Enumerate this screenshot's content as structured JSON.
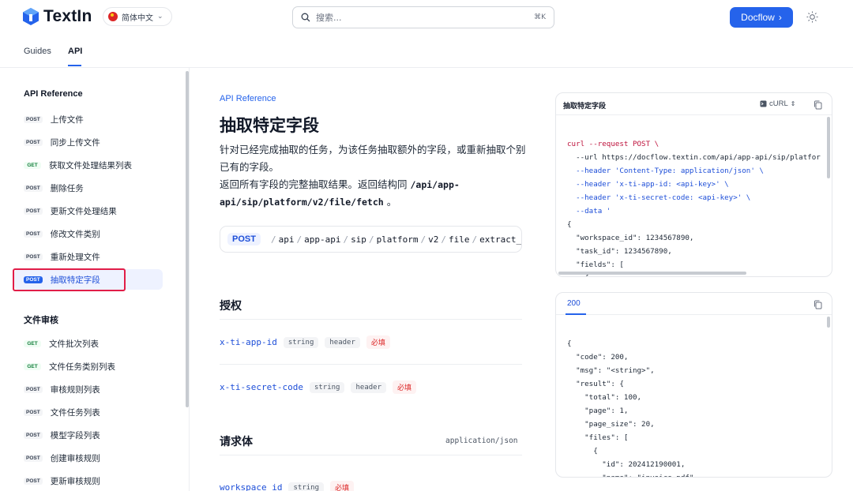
{
  "header": {
    "logo_text": "TextIn",
    "language": "简体中文",
    "search_placeholder": "搜索...",
    "search_shortcut": "⌘K",
    "docflow_label": "Docflow",
    "docflow_arrow": "›"
  },
  "tabs": [
    {
      "label": "Guides"
    },
    {
      "label": "API"
    }
  ],
  "sidebar": {
    "sections": [
      {
        "title": "API Reference",
        "items": [
          {
            "method": "POST",
            "label": "上传文件"
          },
          {
            "method": "POST",
            "label": "同步上传文件"
          },
          {
            "method": "GET",
            "label": "获取文件处理结果列表"
          },
          {
            "method": "POST",
            "label": "删除任务"
          },
          {
            "method": "POST",
            "label": "更新文件处理结果"
          },
          {
            "method": "POST",
            "label": "修改文件类别"
          },
          {
            "method": "POST",
            "label": "重新处理文件"
          },
          {
            "method": "POST",
            "label": "抽取特定字段"
          }
        ]
      },
      {
        "title": "文件审核",
        "items": [
          {
            "method": "GET",
            "label": "文件批次列表"
          },
          {
            "method": "GET",
            "label": "文件任务类别列表"
          },
          {
            "method": "POST",
            "label": "审核规则列表"
          },
          {
            "method": "POST",
            "label": "文件任务列表"
          },
          {
            "method": "POST",
            "label": "模型字段列表"
          },
          {
            "method": "POST",
            "label": "创建审核规则"
          },
          {
            "method": "POST",
            "label": "更新审核规则"
          }
        ]
      }
    ]
  },
  "main": {
    "breadcrumb": "API Reference",
    "title": "抽取特定字段",
    "desc_line1": "针对已经完成抽取的任务，为该任务抽取额外的字段，或重新抽取个别已有的字段。",
    "desc_line2_prefix": "返回所有字段的完整抽取结果。返回结构同 ",
    "desc_line2_code": "/api/app-api/sip/platform/v2/file/fetch",
    "desc_line2_suffix": " 。",
    "endpoint_method": "POST",
    "endpoint_path": [
      "api",
      "app-api",
      "sip",
      "platform",
      "v2",
      "file",
      "extract_fiel"
    ],
    "auth_title": "授权",
    "auth_params": [
      {
        "name": "x-ti-app-id",
        "type": "string",
        "location": "header",
        "required": "必填"
      },
      {
        "name": "x-ti-secret-code",
        "type": "string",
        "location": "header",
        "required": "必填"
      }
    ],
    "body_title": "请求体",
    "body_content_type": "application/json",
    "body_params": [
      {
        "name": "workspace_id",
        "type": "string",
        "required": "必填"
      }
    ]
  },
  "request_panel": {
    "title": "抽取特定字段",
    "language": "cURL",
    "lines": [
      "curl --request POST \\",
      "  --url https://docflow.textin.com/api/app-api/sip/platfor",
      "  --header 'Content-Type: application/json' \\",
      "  --header 'x-ti-app-id: <api-key>' \\",
      "  --header 'x-ti-secret-code: <api-key>' \\",
      "  --data '",
      "{",
      "  \"workspace_id\": 1234567890,",
      "  \"task_id\": 1234567890,",
      "  \"fields\": [",
      "    {"
    ]
  },
  "response_panel": {
    "status": "200",
    "lines": [
      "{",
      "  \"code\": 200,",
      "  \"msg\": \"<string>\",",
      "  \"result\": {",
      "    \"total\": 100,",
      "    \"page\": 1,",
      "    \"page_size\": 20,",
      "    \"files\": [",
      "      {",
      "        \"id\": 202412190001,",
      "        \"name\": \"invoice.pdf\","
    ]
  }
}
